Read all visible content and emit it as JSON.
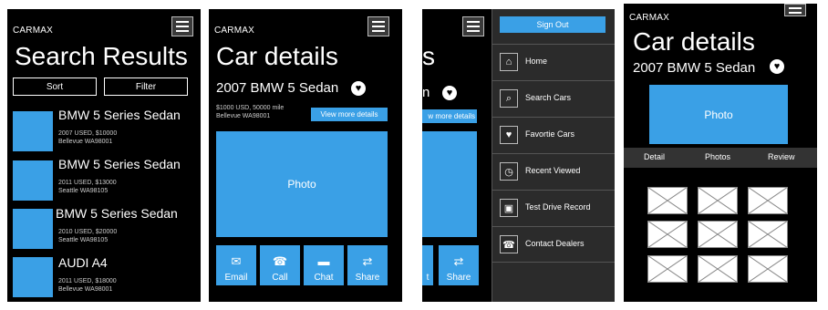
{
  "brand": "CARMAX",
  "screen1": {
    "title": "Search Results",
    "sort_label": "Sort",
    "filter_label": "Filter",
    "results": [
      {
        "name": "BMW 5 Series Sedan",
        "line1": "2007 USED, $10000",
        "line2": "Bellevue WA98001"
      },
      {
        "name": "BMW 5 Series Sedan",
        "line1": "2011 USED, $13000",
        "line2": "Seattle WA98105"
      },
      {
        "name": "BMW 5 Series Sedan",
        "line1": "2010 USED, $20000",
        "line2": "Seattle WA98105"
      },
      {
        "name": "AUDI A4",
        "line1": "2011 USED, $18000",
        "line2": "Bellevue WA98001"
      }
    ]
  },
  "screen2": {
    "title": "Car details",
    "car": "2007 BMW 5 Sedan",
    "detail_line1": "$1000 USD, 50000 mile",
    "detail_line2": "Bellevue WA98001",
    "view_more": "View more details",
    "photo": "Photo",
    "actions": [
      {
        "icon": "envelope-icon",
        "glyph": "✉",
        "label": "Email"
      },
      {
        "icon": "phone-icon",
        "glyph": "☎",
        "label": "Call"
      },
      {
        "icon": "chat-icon",
        "glyph": "▬",
        "label": "Chat"
      },
      {
        "icon": "share-icon",
        "glyph": "⇄",
        "label": "Share"
      }
    ]
  },
  "screen3": {
    "partial_title": "s",
    "partial_sub": "n",
    "partial_view_more": "w more details",
    "partial_action1": "t",
    "partial_action2": "Share",
    "sign_out": "Sign Out",
    "menu": [
      {
        "icon": "home-icon",
        "glyph": "⌂",
        "label": "Home"
      },
      {
        "icon": "search-icon",
        "glyph": "⌕",
        "label": "Search Cars"
      },
      {
        "icon": "heart-icon",
        "glyph": "♥",
        "label": "Favortie Cars"
      },
      {
        "icon": "clock-icon",
        "glyph": "◷",
        "label": "Recent Viewed"
      },
      {
        "icon": "car-icon",
        "glyph": "▣",
        "label": "Test Drive Record"
      },
      {
        "icon": "phone-icon",
        "glyph": "☎",
        "label": "Contact Dealers"
      }
    ]
  },
  "screen4": {
    "title": "Car details",
    "car": "2007 BMW 5 Sedan",
    "photo": "Photo",
    "tabs": [
      "Detail",
      "Photos",
      "Review"
    ]
  },
  "colors": {
    "accent": "#3aa0e6",
    "background": "#000000",
    "menu": "#2b2b2b"
  }
}
